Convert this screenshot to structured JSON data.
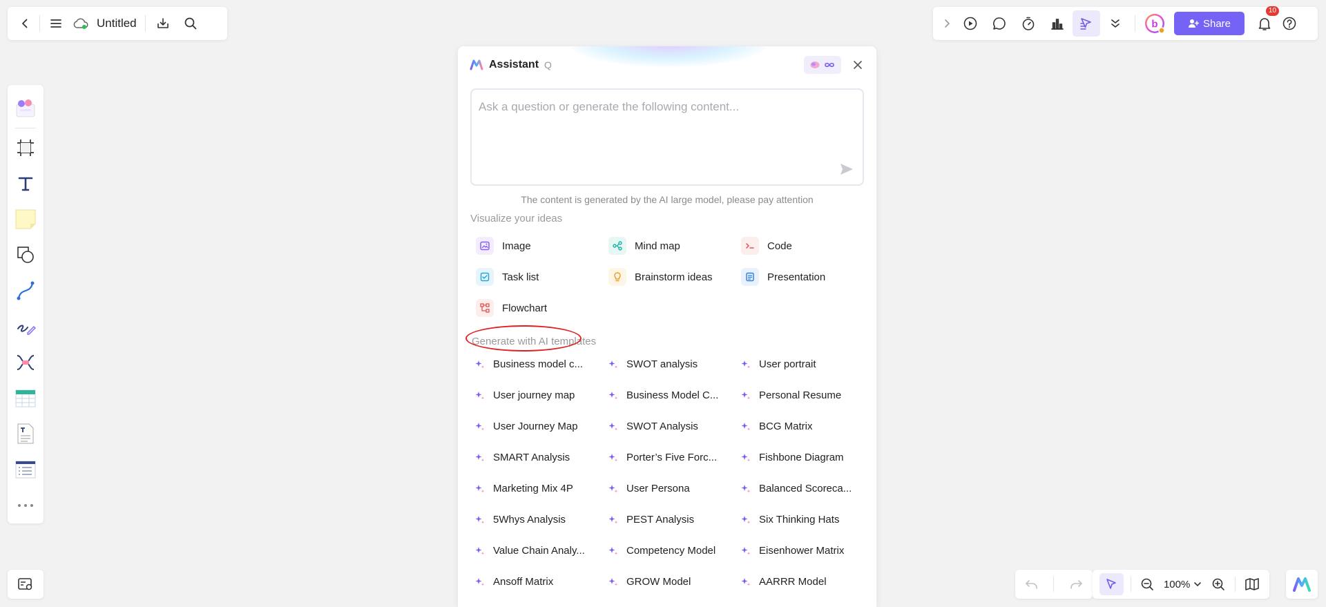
{
  "document": {
    "title": "Untitled"
  },
  "toolbar": {
    "share_label": "Share",
    "notifications_count": "10"
  },
  "zoom": {
    "level": "100%"
  },
  "assistant": {
    "title": "Assistant",
    "q_label": "Q",
    "input_placeholder": "Ask a question or generate the following content...",
    "disclaimer": "The content is generated by the AI large model, please pay attention",
    "visualize_title": "Visualize your ideas",
    "visualize_items": [
      {
        "label": "Image",
        "icon": "image-icon",
        "color": "#8a5cf6"
      },
      {
        "label": "Mind map",
        "icon": "mind-map-icon",
        "color": "#17b3a3"
      },
      {
        "label": "Code",
        "icon": "code-icon",
        "color": "#e05252"
      },
      {
        "label": "Task list",
        "icon": "task-list-icon",
        "color": "#22a6d8"
      },
      {
        "label": "Brainstorm ideas",
        "icon": "lightbulb-icon",
        "color": "#f0a020"
      },
      {
        "label": "Presentation",
        "icon": "presentation-icon",
        "color": "#2f7fe0"
      },
      {
        "label": "Flowchart",
        "icon": "flowchart-icon",
        "color": "#e05252"
      }
    ],
    "templates_title": "Generate with AI templates",
    "templates": [
      "Business model c...",
      "SWOT analysis",
      "User portrait",
      "User journey map",
      "Business Model C...",
      "Personal Resume",
      "User Journey Map",
      "SWOT Analysis",
      "BCG Matrix",
      "SMART Analysis",
      "Porter’s Five Forc...",
      "Fishbone Diagram",
      "Marketing Mix 4P",
      "User Persona",
      "Balanced Scoreca...",
      "5Whys Analysis",
      "PEST Analysis",
      "Six Thinking Hats",
      "Value Chain Analy...",
      "Competency Model",
      "Eisenhower Matrix",
      "Ansoff Matrix",
      "GROW Model",
      "AARRR Model"
    ]
  },
  "colors": {
    "accent": "#7563f5",
    "highlight_ellipse": "#e02020"
  }
}
